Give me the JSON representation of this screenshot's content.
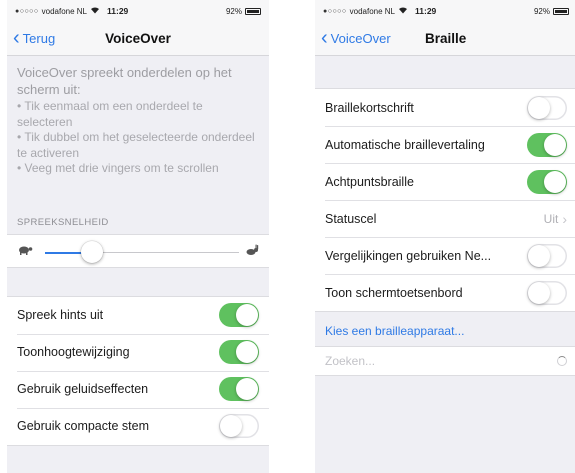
{
  "status_bar": {
    "signal": "●○○○○",
    "carrier": "vodafone NL",
    "wifi_icon": "wifi-icon",
    "time": "11:29",
    "battery_text": "92%",
    "battery_level": 0.92
  },
  "left_screen": {
    "back_label": "Terug",
    "title": "VoiceOver",
    "description": {
      "title": "VoiceOver spreekt onderdelen op het scherm uit:",
      "items": [
        "• Tik eenmaal om een onderdeel te selecteren",
        "• Tik dubbel om het geselecteerde onderdeel te activeren",
        "• Veeg met drie vingers om te scrollen"
      ]
    },
    "speech_rate": {
      "header": "SPREEKSNELHEID",
      "value": 0.24,
      "slow_icon": "turtle-icon",
      "fast_icon": "rabbit-icon"
    },
    "settings": [
      {
        "label": "Spreek hints uit",
        "on": true
      },
      {
        "label": "Toonhoogtewijziging",
        "on": true
      },
      {
        "label": "Gebruik geluidseffecten",
        "on": true
      },
      {
        "label": "Gebruik compacte stem",
        "on": false
      }
    ]
  },
  "right_screen": {
    "back_label": "VoiceOver",
    "title": "Braille",
    "settings": [
      {
        "label": "Braillekortschrift",
        "type": "toggle",
        "on": false
      },
      {
        "label": "Automatische braillevertaling",
        "type": "toggle",
        "on": true
      },
      {
        "label": "Achtpuntsbraille",
        "type": "toggle",
        "on": true
      },
      {
        "label": "Statuscel",
        "type": "detail",
        "value": "Uit"
      },
      {
        "label": "Vergelijkingen gebruiken Ne...",
        "type": "toggle",
        "on": false
      },
      {
        "label": "Toon schermtoetsenbord",
        "type": "toggle",
        "on": false
      }
    ],
    "choose_device": "Kies een brailleapparaat...",
    "search_placeholder": "Zoeken..."
  },
  "colors": {
    "accent": "#2f7ae5",
    "toggle_on": "#5fc15f",
    "background": "#efeff4"
  }
}
